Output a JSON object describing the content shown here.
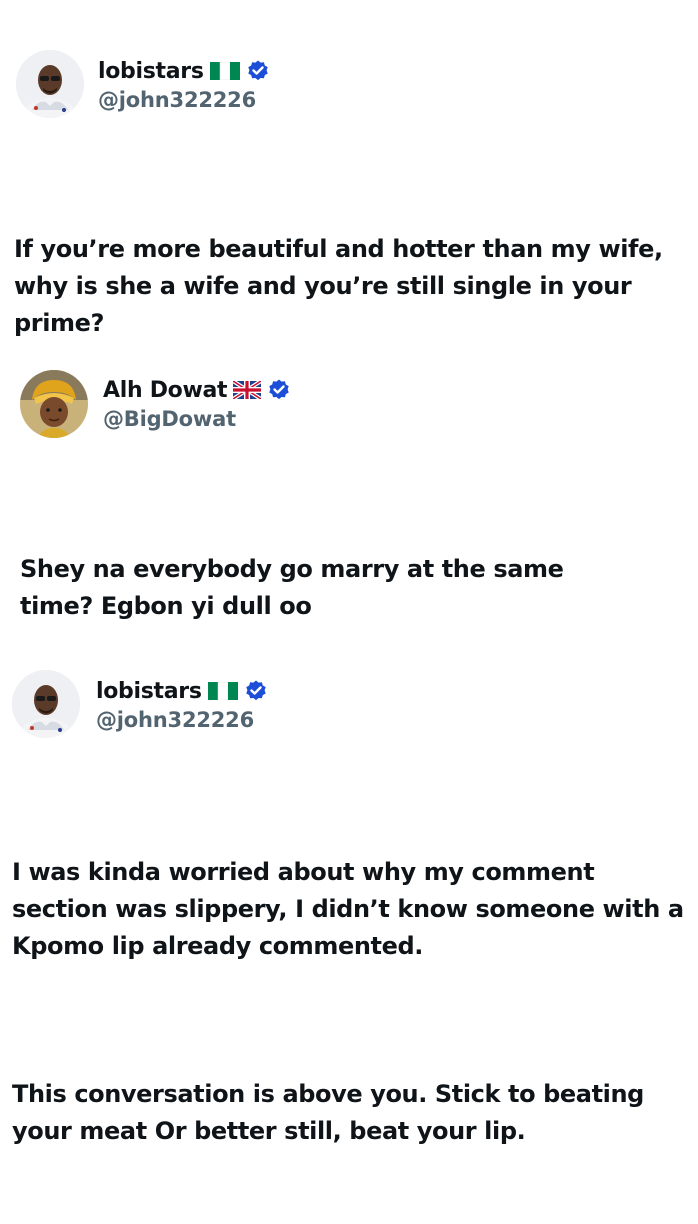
{
  "tweets": [
    {
      "display_name": "lobistars",
      "flag": "nigeria-flag",
      "verified": true,
      "handle": "@john322226",
      "text_lines": [
        "If you’re more beautiful and hotter than my wife, why is she a wife and you’re still single in your prime?"
      ]
    },
    {
      "display_name": "Alh Dowat",
      "flag": "uk-flag",
      "verified": true,
      "handle": "@BigDowat",
      "text_lines": [
        "Shey na everybody go marry at the same time? Egbon yi dull oo"
      ]
    },
    {
      "display_name": "lobistars",
      "flag": "nigeria-flag",
      "verified": true,
      "handle": "@john322226",
      "text_lines": [
        "I was kinda worried about why my comment section was slippery, I didn’t know someone with a Kpomo lip already commented.",
        "This conversation is above you. Stick to beating your meat Or better still, beat your lip."
      ]
    }
  ],
  "colors": {
    "verified_badge": "#1d4ed8",
    "handle": "#536471",
    "text": "#0f1419",
    "nigeria_green": "#008751"
  }
}
